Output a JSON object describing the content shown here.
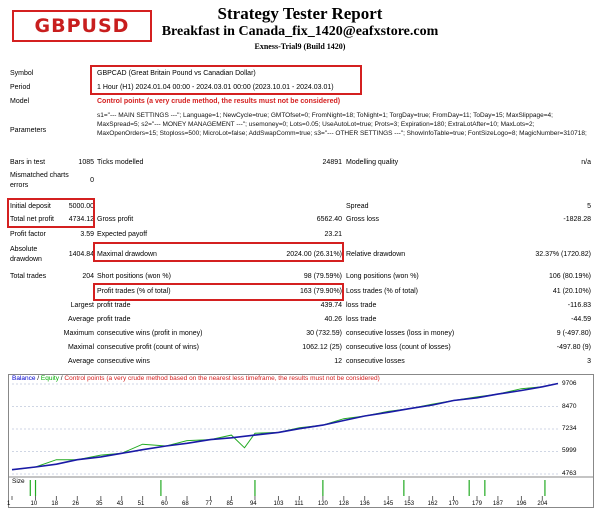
{
  "symbol_tag": "GBPUSD",
  "header": {
    "title": "Strategy Tester Report",
    "subtitle": "Breakfast in Canada_fix_1420@eafxstore.com",
    "build": "Exness-Trial9 (Build 1420)"
  },
  "info": {
    "symbol_label": "Symbol",
    "symbol_value": "GBPCAD (Great Britain Pound vs Canadian Dollar)",
    "period_label": "Period",
    "period_value": "1 Hour (H1) 2024.01.04 00:00 - 2024.03.01 00:00 (2023.10.01 - 2024.03.01)",
    "model_label": "Model",
    "model_value": "Control points (a very crude method, the results must not be considered)",
    "parameters_label": "Parameters",
    "parameters_value": "s1=\"--- MAIN SETTINGS ---\"; Language=1; NewCycle=true; GMTOfset=0; FromNight=18; ToNight=1; TorgDay=true; FromDay=11; ToDay=15; MaxSlippage=4; MaxSpread=5; s2=\"--- MONEY MANAGEMENT ---\"; usemoney=0; Lots=0.05; UseAutoLot=true; Prots=3; Expiration=180; ExtraLotAfter=10; MaxLots=2; MaxOpenOrders=15; Stoploss=500; MicroLot=false; AddSwapComm=true; s3=\"--- OTHER SETTINGS ---\"; ShowInfoTable=true; FontSizeLogo=8; MagicNumber=310718;"
  },
  "stats": {
    "bars_label": "Bars in test",
    "bars_value": "1085",
    "ticks_label": "Ticks modelled",
    "ticks_value": "24891",
    "quality_label": "Modelling quality",
    "quality_value": "n/a",
    "mismatch_label": "Mismatched charts errors",
    "mismatch_value": "0",
    "deposit_label": "Initial deposit",
    "deposit_value": "5000.00",
    "spread_label": "Spread",
    "spread_value": "5",
    "netprofit_label": "Total net profit",
    "netprofit_value": "4734.12",
    "grossprofit_label": "Gross profit",
    "grossprofit_value": "6562.40",
    "grossloss_label": "Gross loss",
    "grossloss_value": "-1828.28",
    "pf_label": "Profit factor",
    "pf_value": "3.59",
    "ep_label": "Expected payoff",
    "ep_value": "23.21",
    "absdd_label": "Absolute drawdown",
    "absdd_value": "1404.84",
    "maxdd_label": "Maximal drawdown",
    "maxdd_value": "2024.00 (26.31%)",
    "reldd_label": "Relative drawdown",
    "reldd_value": "32.37% (1720.82)",
    "trades_label": "Total trades",
    "trades_value": "204",
    "short_label": "Short positions (won %)",
    "short_value": "98 (79.59%)",
    "long_label": "Long positions (won %)",
    "long_value": "106 (80.19%)",
    "profittr_label": "Profit trades (% of total)",
    "profittr_value": "163 (79.90%)",
    "losstr_label": "Loss trades (% of total)",
    "losstr_value": "41 (20.10%)",
    "largest_label": "Largest",
    "largest_profit_label": "profit trade",
    "largest_profit_value": "439.74",
    "largest_loss_label": "loss trade",
    "largest_loss_value": "-116.83",
    "average_label": "Average",
    "average_profit_label": "profit trade",
    "average_profit_value": "40.26",
    "average_loss_label": "loss trade",
    "average_loss_value": "-44.59",
    "max1_label": "Maximum",
    "max_cw_label": "consecutive wins (profit in money)",
    "max_cw_value": "30 (732.59)",
    "max_cl_label": "consecutive losses (loss in money)",
    "max_cl_value": "9 (-497.80)",
    "maximal_label": "Maximal",
    "maximal_cp_label": "consecutive profit (count of wins)",
    "maximal_cp_value": "1062.12 (25)",
    "maximal_cls_label": "consecutive loss (count of losses)",
    "maximal_cls_value": "-497.80 (9)",
    "avg2_label": "Average",
    "avg_cw_label": "consecutive wins",
    "avg_cw_value": "12",
    "avg_cl_label": "consecutive losses",
    "avg_cl_value": "3"
  },
  "legend": {
    "balance": "Balance",
    "sep1": " / ",
    "equity": "Equity",
    "sep2": " / ",
    "control": "Control points (a very crude method based on the nearest less timeframe, the results must not be considered)"
  },
  "size_label": "Size",
  "colors": {
    "balance": "#1a1aa6",
    "equity": "#22aa22",
    "accent_red": "#d42020",
    "size_bars": "#22aa22"
  },
  "chart_data": {
    "type": "line",
    "ylim": [
      4763,
      9706
    ],
    "y_ticks": [
      "9706",
      "8470",
      "7234",
      "5999",
      "4763"
    ],
    "x_ticks": [
      "1",
      "10",
      "18",
      "26",
      "35",
      "43",
      "51",
      "60",
      "68",
      "77",
      "85",
      "94",
      "103",
      "111",
      "120",
      "128",
      "136",
      "145",
      "153",
      "162",
      "170",
      "179",
      "187",
      "196",
      "204"
    ],
    "xlim": [
      1,
      210
    ],
    "series": [
      {
        "name": "Balance",
        "x": [
          1,
          10,
          18,
          26,
          35,
          43,
          51,
          60,
          68,
          77,
          85,
          94,
          103,
          111,
          120,
          128,
          136,
          145,
          153,
          162,
          170,
          179,
          187,
          196,
          204,
          210
        ],
        "values": [
          5000,
          5150,
          5300,
          5550,
          5700,
          5900,
          6100,
          6300,
          6450,
          6650,
          6750,
          6900,
          7050,
          7250,
          7450,
          7700,
          7950,
          8150,
          8350,
          8550,
          8800,
          8950,
          9150,
          9350,
          9550,
          9734
        ]
      },
      {
        "name": "Equity",
        "x": [
          1,
          10,
          18,
          26,
          35,
          43,
          51,
          60,
          68,
          77,
          85,
          90,
          94,
          103,
          111,
          120,
          128,
          136,
          145,
          153,
          162,
          170,
          179,
          187,
          196,
          204,
          210
        ],
        "values": [
          5000,
          5150,
          5550,
          5550,
          5800,
          5900,
          6400,
          6300,
          6600,
          6650,
          6900,
          6200,
          7000,
          7050,
          7300,
          7450,
          7800,
          7950,
          8200,
          8350,
          8600,
          8800,
          9000,
          9150,
          9450,
          9550,
          9734
        ]
      }
    ],
    "size_bars": [
      8,
      10,
      58,
      94,
      120,
      151,
      176,
      182,
      205
    ]
  }
}
